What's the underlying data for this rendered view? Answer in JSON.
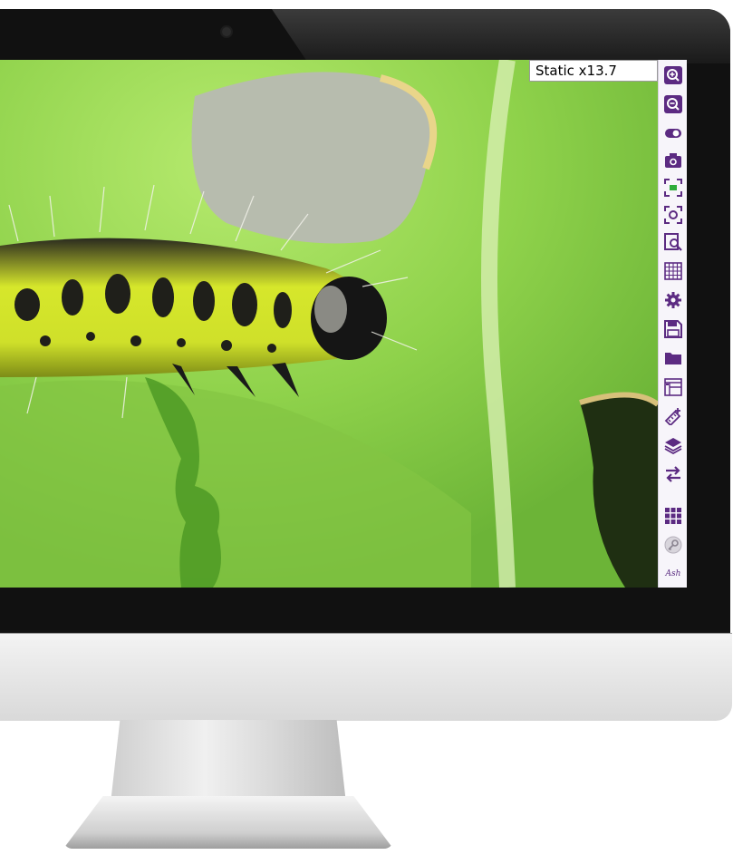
{
  "viewer": {
    "zoom_label": "Static x13.7"
  },
  "toolbar": {
    "accent_color": "#5c2b82",
    "tools": [
      {
        "name": "zoom-in-icon"
      },
      {
        "name": "zoom-out-icon"
      },
      {
        "name": "toggle-icon"
      },
      {
        "name": "camera-icon"
      },
      {
        "name": "fit-screen-icon"
      },
      {
        "name": "capture-frame-icon"
      },
      {
        "name": "preview-search-icon"
      },
      {
        "name": "grid-overlay-icon"
      },
      {
        "name": "settings-gear-icon"
      },
      {
        "name": "save-disk-icon"
      },
      {
        "name": "open-folder-icon"
      },
      {
        "name": "layout-icon"
      },
      {
        "name": "measure-ruler-icon"
      },
      {
        "name": "layers-icon"
      },
      {
        "name": "swap-arrows-icon"
      },
      {
        "name": "apps-grid-icon"
      },
      {
        "name": "key-icon"
      }
    ],
    "brand": "Ash"
  }
}
